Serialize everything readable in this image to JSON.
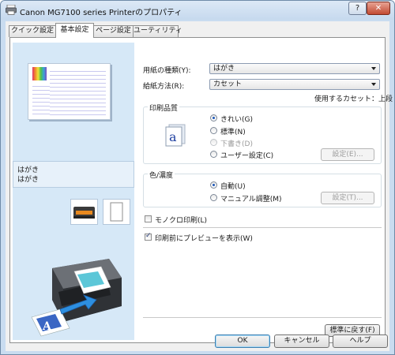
{
  "window": {
    "title": "Canon MG7100 series Printerのプロパティ",
    "help_glyph": "?",
    "close_glyph": "✕"
  },
  "tabs": [
    {
      "label": "クイック設定"
    },
    {
      "label": "基本設定"
    },
    {
      "label": "ページ設定"
    },
    {
      "label": "ユーティリティ"
    }
  ],
  "preview": {
    "media_lines": [
      "はがき",
      "はがき"
    ]
  },
  "main": {
    "media_type_label": "用紙の種類(Y):",
    "media_type_value": "はがき",
    "paper_source_label": "給紙方法(R):",
    "paper_source_value": "カセット",
    "cassette_info": "使用するカセット：上段",
    "quality": {
      "legend": "印刷品質",
      "options": [
        {
          "label": "きれい(G)",
          "selected": true,
          "enabled": true
        },
        {
          "label": "標準(N)",
          "selected": false,
          "enabled": true
        },
        {
          "label": "下書き(D)",
          "selected": false,
          "enabled": false
        },
        {
          "label": "ユーザー設定(C)",
          "selected": false,
          "enabled": true
        }
      ],
      "settings_button": "設定(E)..."
    },
    "color": {
      "legend": "色/濃度",
      "options": [
        {
          "label": "自動(U)",
          "selected": true
        },
        {
          "label": "マニュアル調整(M)",
          "selected": false
        }
      ],
      "settings_button": "設定(T)..."
    },
    "monochrome_label": "モノクロ印刷(L)",
    "monochrome_checked": false,
    "preview_before_print_label": "印刷前にプレビューを表示(W)",
    "preview_before_print_checked": true,
    "defaults_button": "標準に戻す(F)"
  },
  "footer": {
    "ok": "OK",
    "cancel": "キャンセル",
    "help": "ヘルプ"
  },
  "colors": {
    "title_bg": "#c9dcf0",
    "preview_bg": "#d6e8f7",
    "close_btn": "#c24a32",
    "radio_dot": "#1d58b8"
  }
}
